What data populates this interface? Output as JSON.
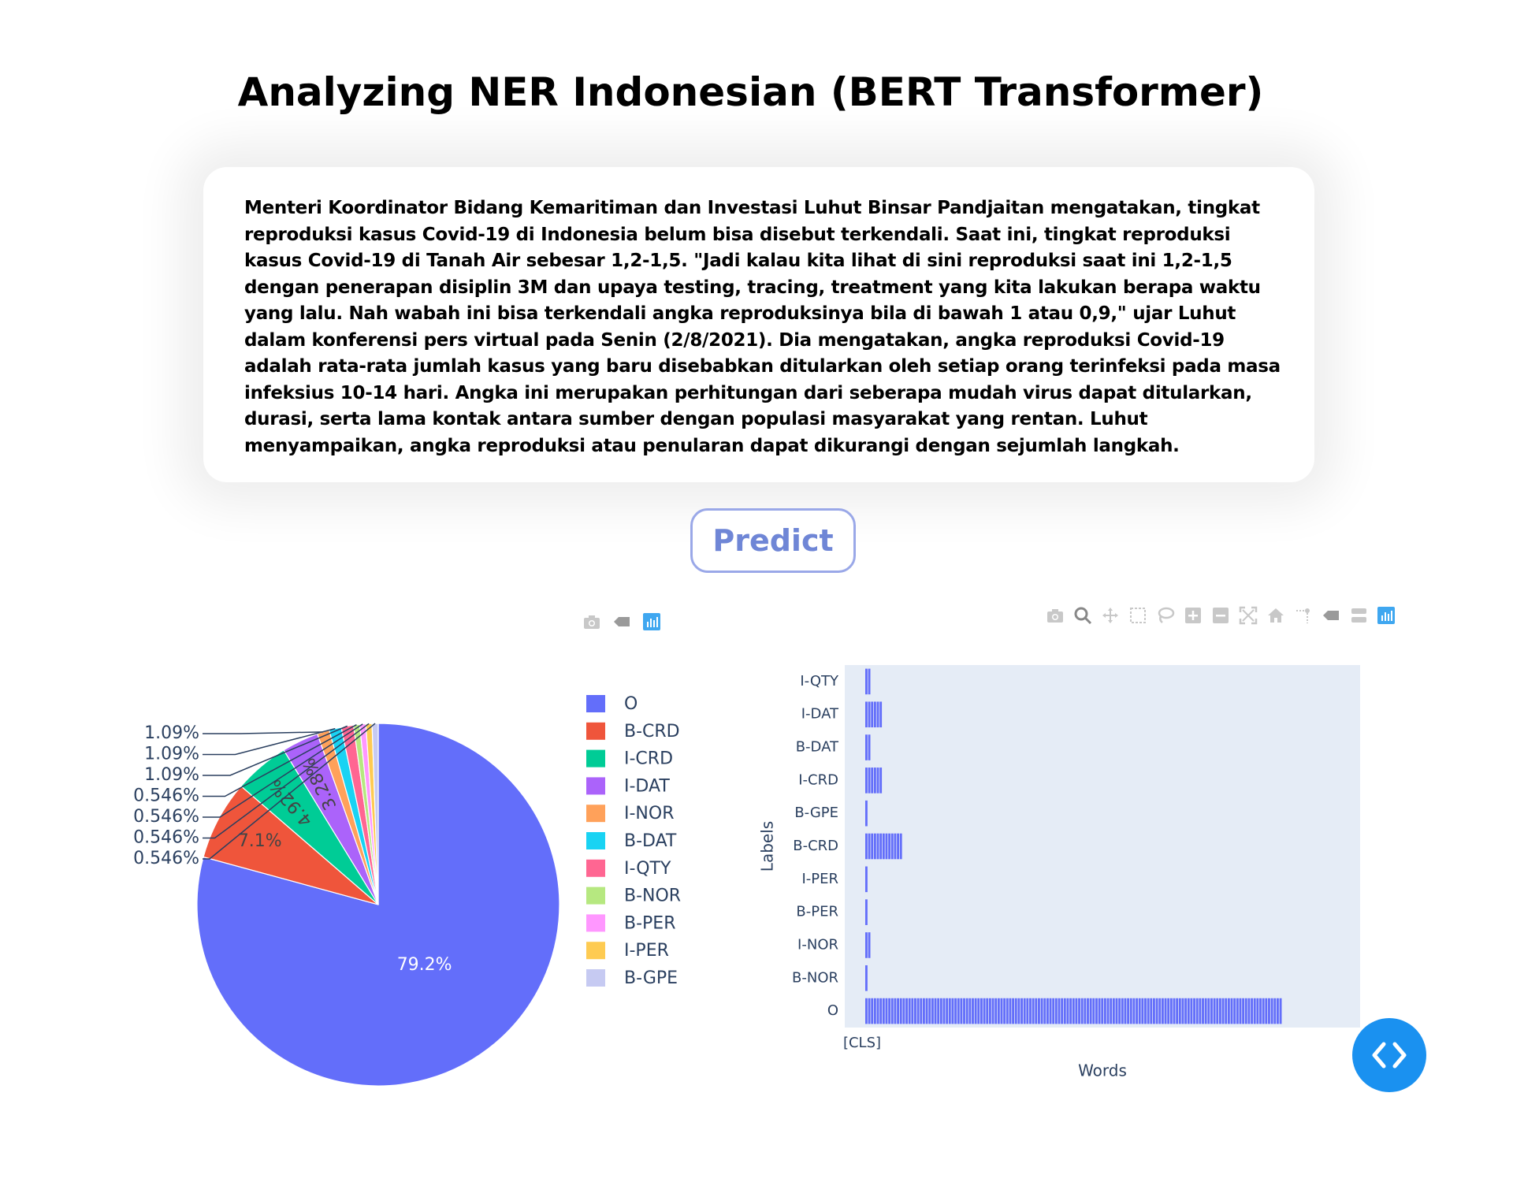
{
  "page": {
    "title": "Analyzing NER Indonesian (BERT Transformer)",
    "input_text": "Menteri Koordinator Bidang Kemaritiman dan Investasi Luhut Binsar Pandjaitan mengatakan, tingkat reproduksi kasus Covid-19 di Indonesia belum bisa disebut terkendali.  Saat ini, tingkat reproduksi kasus Covid-19 di Tanah Air sebesar 1,2-1,5. \"Jadi kalau kita lihat di sini reproduksi saat ini 1,2-1,5 dengan penerapan disiplin 3M dan upaya testing, tracing, treatment yang kita lakukan berapa waktu yang lalu. Nah wabah ini bisa terkendali angka reproduksinya bila di bawah 1 atau 0,9,\" ujar Luhut dalam konferensi pers virtual pada Senin (2/8/2021). Dia mengatakan, angka reproduksi Covid-19 adalah rata-rata jumlah kasus yang baru disebabkan ditularkan oleh setiap orang terinfeksi pada masa infeksius 10-14 hari. Angka ini merupakan perhitungan dari seberapa mudah virus dapat ditularkan, durasi, serta lama kontak antara sumber dengan populasi masyarakat yang rentan. Luhut menyampaikan, angka reproduksi atau penularan dapat dikurangi dengan sejumlah langkah.",
    "predict_label": "Predict"
  },
  "modebar_pie": [
    "camera-icon",
    "hover-tag-icon",
    "plotly-logo-icon"
  ],
  "modebar_bar": [
    "camera-icon",
    "zoom-icon",
    "pan-icon",
    "box-select-icon",
    "lasso-icon",
    "zoom-in-icon",
    "zoom-out-icon",
    "autoscale-icon",
    "reset-axes-icon",
    "spike-lines-icon",
    "hover-closest-icon",
    "hover-compare-icon",
    "plotly-logo-icon"
  ],
  "chart_data": [
    {
      "type": "pie",
      "title": "",
      "labels": [
        "O",
        "B-CRD",
        "I-CRD",
        "I-DAT",
        "I-NOR",
        "B-DAT",
        "I-QTY",
        "B-NOR",
        "B-PER",
        "I-PER",
        "B-GPE"
      ],
      "values": [
        79.2,
        7.1,
        4.92,
        3.28,
        1.09,
        1.09,
        1.09,
        0.546,
        0.546,
        0.546,
        0.546
      ],
      "text": [
        "79.2%",
        "7.1%",
        "4.92%",
        "3.28%",
        "1.09%",
        "1.09%",
        "1.09%",
        "0.546%",
        "0.546%",
        "0.546%",
        "0.546%"
      ],
      "colors": [
        "#636efa",
        "#ef553b",
        "#00cc96",
        "#ab63fa",
        "#ffa15a",
        "#19d3f3",
        "#ff6692",
        "#b6e880",
        "#ff97ff",
        "#fecb52",
        "#c6caf2"
      ],
      "legend_placement": "right"
    },
    {
      "type": "bar",
      "orientation": "horizontal",
      "title": "",
      "xlabel": "Words",
      "ylabel": "Labels",
      "categories": [
        "I-QTY",
        "I-DAT",
        "B-DAT",
        "I-CRD",
        "B-GPE",
        "B-CRD",
        "I-PER",
        "B-PER",
        "I-NOR",
        "B-NOR",
        "O"
      ],
      "word_counts": [
        2,
        6,
        2,
        6,
        1,
        13,
        1,
        1,
        2,
        1,
        145
      ],
      "x_tick_labels": [
        "[CLS]"
      ],
      "bar_color": "#636efa",
      "plot_background": "#e5ecf6",
      "grid": false
    }
  ]
}
